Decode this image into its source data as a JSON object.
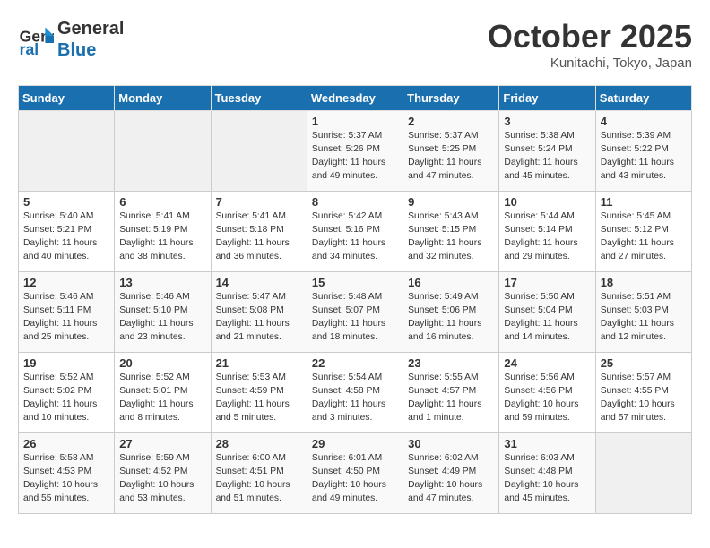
{
  "header": {
    "logo_line1": "General",
    "logo_line2": "Blue",
    "month": "October 2025",
    "location": "Kunitachi, Tokyo, Japan"
  },
  "weekdays": [
    "Sunday",
    "Monday",
    "Tuesday",
    "Wednesday",
    "Thursday",
    "Friday",
    "Saturday"
  ],
  "weeks": [
    [
      {
        "day": "",
        "info": ""
      },
      {
        "day": "",
        "info": ""
      },
      {
        "day": "",
        "info": ""
      },
      {
        "day": "1",
        "info": "Sunrise: 5:37 AM\nSunset: 5:26 PM\nDaylight: 11 hours\nand 49 minutes."
      },
      {
        "day": "2",
        "info": "Sunrise: 5:37 AM\nSunset: 5:25 PM\nDaylight: 11 hours\nand 47 minutes."
      },
      {
        "day": "3",
        "info": "Sunrise: 5:38 AM\nSunset: 5:24 PM\nDaylight: 11 hours\nand 45 minutes."
      },
      {
        "day": "4",
        "info": "Sunrise: 5:39 AM\nSunset: 5:22 PM\nDaylight: 11 hours\nand 43 minutes."
      }
    ],
    [
      {
        "day": "5",
        "info": "Sunrise: 5:40 AM\nSunset: 5:21 PM\nDaylight: 11 hours\nand 40 minutes."
      },
      {
        "day": "6",
        "info": "Sunrise: 5:41 AM\nSunset: 5:19 PM\nDaylight: 11 hours\nand 38 minutes."
      },
      {
        "day": "7",
        "info": "Sunrise: 5:41 AM\nSunset: 5:18 PM\nDaylight: 11 hours\nand 36 minutes."
      },
      {
        "day": "8",
        "info": "Sunrise: 5:42 AM\nSunset: 5:16 PM\nDaylight: 11 hours\nand 34 minutes."
      },
      {
        "day": "9",
        "info": "Sunrise: 5:43 AM\nSunset: 5:15 PM\nDaylight: 11 hours\nand 32 minutes."
      },
      {
        "day": "10",
        "info": "Sunrise: 5:44 AM\nSunset: 5:14 PM\nDaylight: 11 hours\nand 29 minutes."
      },
      {
        "day": "11",
        "info": "Sunrise: 5:45 AM\nSunset: 5:12 PM\nDaylight: 11 hours\nand 27 minutes."
      }
    ],
    [
      {
        "day": "12",
        "info": "Sunrise: 5:46 AM\nSunset: 5:11 PM\nDaylight: 11 hours\nand 25 minutes."
      },
      {
        "day": "13",
        "info": "Sunrise: 5:46 AM\nSunset: 5:10 PM\nDaylight: 11 hours\nand 23 minutes."
      },
      {
        "day": "14",
        "info": "Sunrise: 5:47 AM\nSunset: 5:08 PM\nDaylight: 11 hours\nand 21 minutes."
      },
      {
        "day": "15",
        "info": "Sunrise: 5:48 AM\nSunset: 5:07 PM\nDaylight: 11 hours\nand 18 minutes."
      },
      {
        "day": "16",
        "info": "Sunrise: 5:49 AM\nSunset: 5:06 PM\nDaylight: 11 hours\nand 16 minutes."
      },
      {
        "day": "17",
        "info": "Sunrise: 5:50 AM\nSunset: 5:04 PM\nDaylight: 11 hours\nand 14 minutes."
      },
      {
        "day": "18",
        "info": "Sunrise: 5:51 AM\nSunset: 5:03 PM\nDaylight: 11 hours\nand 12 minutes."
      }
    ],
    [
      {
        "day": "19",
        "info": "Sunrise: 5:52 AM\nSunset: 5:02 PM\nDaylight: 11 hours\nand 10 minutes."
      },
      {
        "day": "20",
        "info": "Sunrise: 5:52 AM\nSunset: 5:01 PM\nDaylight: 11 hours\nand 8 minutes."
      },
      {
        "day": "21",
        "info": "Sunrise: 5:53 AM\nSunset: 4:59 PM\nDaylight: 11 hours\nand 5 minutes."
      },
      {
        "day": "22",
        "info": "Sunrise: 5:54 AM\nSunset: 4:58 PM\nDaylight: 11 hours\nand 3 minutes."
      },
      {
        "day": "23",
        "info": "Sunrise: 5:55 AM\nSunset: 4:57 PM\nDaylight: 11 hours\nand 1 minute."
      },
      {
        "day": "24",
        "info": "Sunrise: 5:56 AM\nSunset: 4:56 PM\nDaylight: 10 hours\nand 59 minutes."
      },
      {
        "day": "25",
        "info": "Sunrise: 5:57 AM\nSunset: 4:55 PM\nDaylight: 10 hours\nand 57 minutes."
      }
    ],
    [
      {
        "day": "26",
        "info": "Sunrise: 5:58 AM\nSunset: 4:53 PM\nDaylight: 10 hours\nand 55 minutes."
      },
      {
        "day": "27",
        "info": "Sunrise: 5:59 AM\nSunset: 4:52 PM\nDaylight: 10 hours\nand 53 minutes."
      },
      {
        "day": "28",
        "info": "Sunrise: 6:00 AM\nSunset: 4:51 PM\nDaylight: 10 hours\nand 51 minutes."
      },
      {
        "day": "29",
        "info": "Sunrise: 6:01 AM\nSunset: 4:50 PM\nDaylight: 10 hours\nand 49 minutes."
      },
      {
        "day": "30",
        "info": "Sunrise: 6:02 AM\nSunset: 4:49 PM\nDaylight: 10 hours\nand 47 minutes."
      },
      {
        "day": "31",
        "info": "Sunrise: 6:03 AM\nSunset: 4:48 PM\nDaylight: 10 hours\nand 45 minutes."
      },
      {
        "day": "",
        "info": ""
      }
    ]
  ]
}
